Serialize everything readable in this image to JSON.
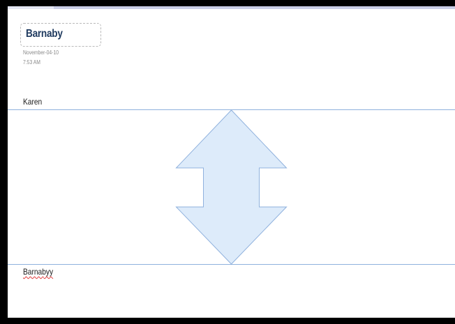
{
  "note": {
    "title": "Barnaby",
    "date": "November-04-10",
    "time": "7:53 AM"
  },
  "labels": {
    "top_name": "Karen",
    "bottom_name": "Barnabyy"
  },
  "drag_handle": {
    "icon": "up-down-arrow-icon",
    "fill": "#ddebfa",
    "stroke": "#8fb1dd"
  },
  "colors": {
    "frame": "#000000",
    "page": "#ffffff",
    "rule": "#8fb1dd",
    "title": "#1f3a5f",
    "spell_error": "#e03030"
  }
}
